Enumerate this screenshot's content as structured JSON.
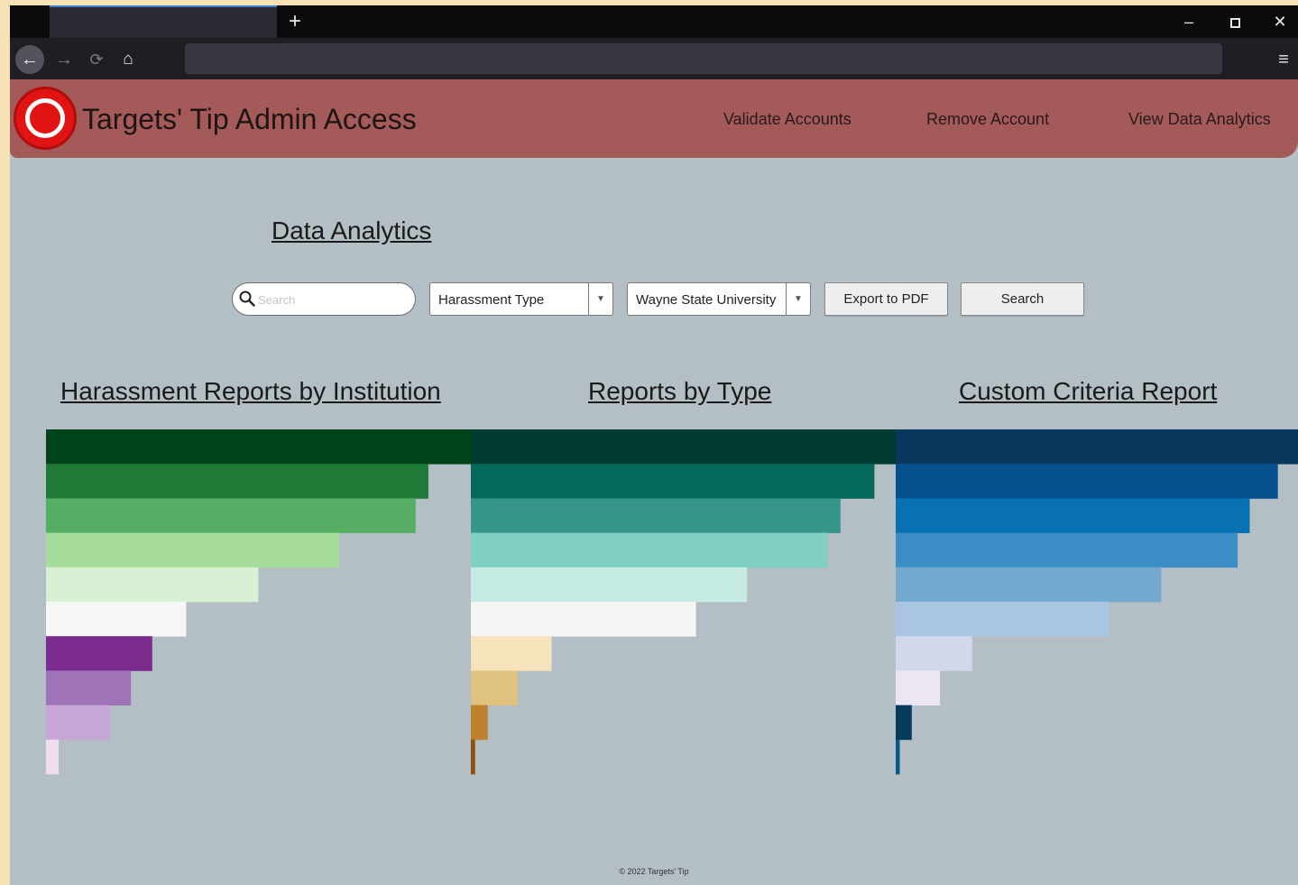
{
  "browser": {
    "tab_title": "",
    "new_tab_symbol": "+",
    "back_symbol": "←",
    "forward_symbol": "→",
    "reload_symbol": "⟳",
    "home_symbol": "⌂",
    "menu_symbol": "≡",
    "minimize_symbol": "–",
    "close_symbol": "✕",
    "url": ""
  },
  "header": {
    "title": "Targets' Tip Admin Access",
    "nav": [
      "Validate Accounts",
      "Remove Account",
      "View Data Analytics"
    ]
  },
  "page": {
    "heading": "Data Analytics"
  },
  "filters": {
    "search_placeholder": "Search",
    "type_select": "Harassment Type",
    "institution_select": "Wayne State University",
    "export_label": "Export to PDF",
    "search_label": "Search"
  },
  "sections": {
    "institution": "Harassment Reports by Institution",
    "type": "Reports by Type",
    "custom": "Custom Criteria Report"
  },
  "chart_data": [
    {
      "type": "bar",
      "title": "Harassment Reports by Institution",
      "orientation": "horizontal",
      "values": [
        100,
        90,
        87,
        69,
        50,
        33,
        25,
        20,
        15,
        3
      ],
      "colors": [
        "#00441b",
        "#1f7a38",
        "#55ae63",
        "#a5dc9c",
        "#d8f0d3",
        "#f6f6f6",
        "#7b2c8e",
        "#9f73b8",
        "#c6a6d6",
        "#efdcef"
      ]
    },
    {
      "type": "bar",
      "title": "Reports by Type",
      "orientation": "horizontal",
      "values": [
        100,
        95,
        87,
        84,
        65,
        53,
        19,
        11,
        4,
        1
      ],
      "colors": [
        "#003c30",
        "#056959",
        "#369689",
        "#7fcfc2",
        "#c6ebe5",
        "#f5f5f5",
        "#f6e3bc",
        "#dfc27d",
        "#bf812d",
        "#8c510a"
      ]
    },
    {
      "type": "bar",
      "title": "Custom Criteria Report",
      "orientation": "horizontal",
      "values": [
        100,
        95,
        88,
        85,
        66,
        53,
        19,
        11,
        4,
        1
      ],
      "colors": [
        "#08385e",
        "#07508e",
        "#0771b2",
        "#3a8ec5",
        "#74a9cf",
        "#aac5e2",
        "#d0d8ea",
        "#ebe6f1",
        "#063b5c",
        "#08588e"
      ]
    }
  ],
  "footer": {
    "text": "© 2022 Targets' Tip"
  }
}
